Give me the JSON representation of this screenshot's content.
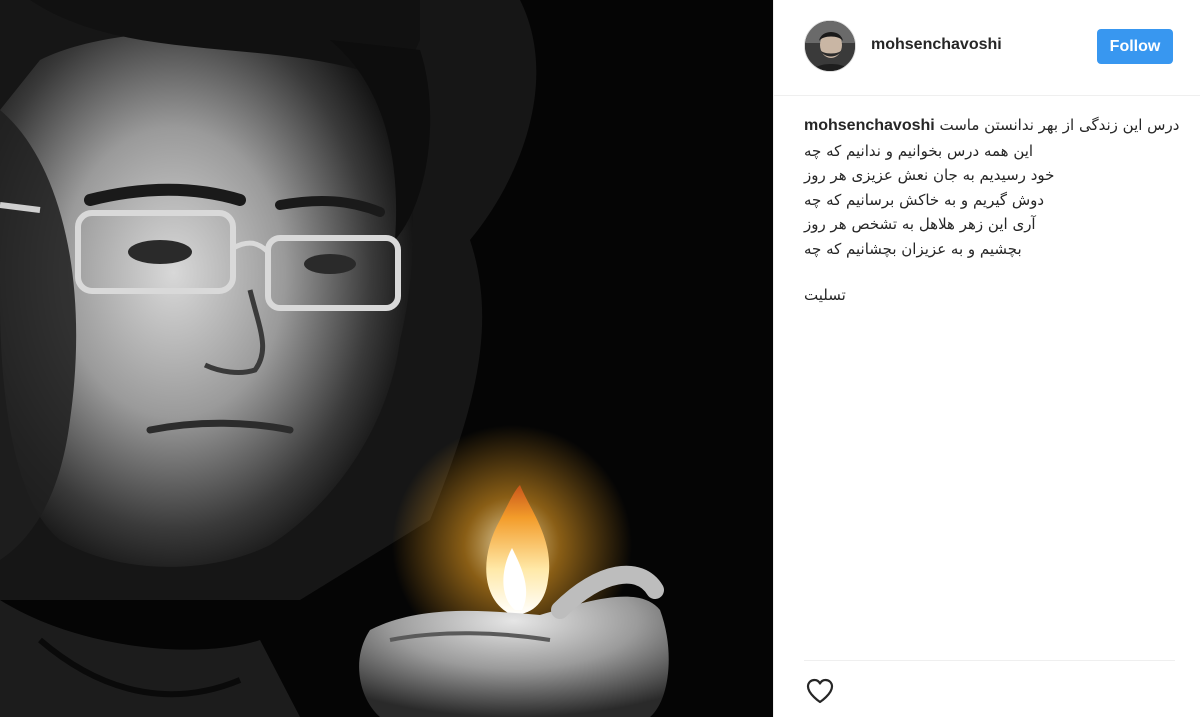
{
  "post": {
    "photo_icon": "portrait-with-lighter-photo"
  },
  "header": {
    "avatar_icon": "profile-avatar",
    "username": "mohsenchavoshi",
    "follow_label": "Follow",
    "follow_color": "#3897f0"
  },
  "caption": {
    "username": "mohsenchavoshi",
    "first_line": "درس این زندگی از بهر ندانستن ماست",
    "lines": [
      "این همه درس بخوانیم و ندانیم که چه",
      "خود رسیدیم به جان نعش عزیزی هر روز",
      "دوش گیریم و به خاکش برسانیم که چه",
      "آری این زهر هلاهل به تشخص هر روز",
      "بچشیم و به عزیزان بچشانیم که چه"
    ],
    "closing": "تسلیت"
  },
  "actions": {
    "like_icon": "heart-icon"
  }
}
